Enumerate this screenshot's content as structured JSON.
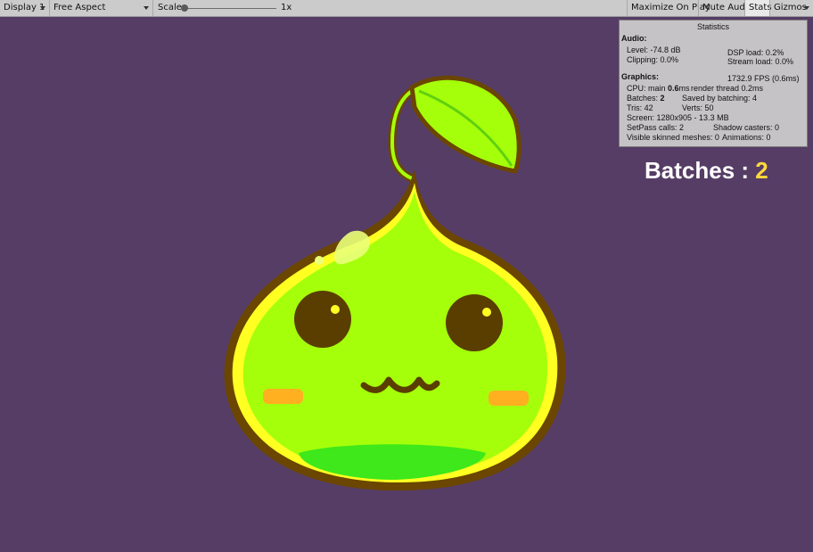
{
  "toolbar": {
    "display": "Display 1",
    "aspect": "Free Aspect",
    "scale_label": "Scale",
    "scale_value": "1x",
    "maximize": "Maximize On Play",
    "mute": "Mute Audio",
    "stats": "Stats",
    "gizmos": "Gizmos"
  },
  "stats": {
    "title": "Statistics",
    "audio_header": "Audio:",
    "level": "Level: -74.8 dB",
    "clipping": "Clipping: 0.0%",
    "dsp": "DSP load: 0.2%",
    "stream": "Stream load: 0.0%",
    "graphics_header": "Graphics:",
    "fps": "1732.9 FPS (0.6ms)",
    "cpu_prefix": "CPU: main ",
    "cpu_value": "0.6",
    "cpu_suffix": "ms",
    "render_thread": "render thread 0.2ms",
    "batches_label": "Batches: ",
    "batches_value": "2",
    "saved_batching": "Saved by batching: 4",
    "tris": "Tris: 42",
    "verts": "Verts: 50",
    "screen": "Screen: 1280x905 - 13.3 MB",
    "setpass": "SetPass calls: 2",
    "shadow": "Shadow casters: 0",
    "skinned": "Visible skinned meshes: 0",
    "animations": "Animations: 0"
  },
  "overlay": {
    "label": "Batches : ",
    "value": "2"
  },
  "colors": {
    "background": "#553d66",
    "slime_body": "#a6ff0a",
    "outline": "#6b4600",
    "highlight": "#ffff22",
    "cheek": "#ffb020",
    "mouth_shadow": "#3ee81a",
    "overlay_number": "#ffd93b"
  }
}
